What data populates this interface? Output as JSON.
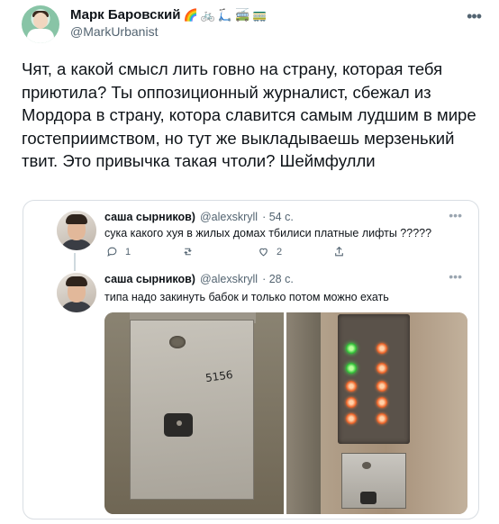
{
  "tweet": {
    "author": {
      "display_name": "Марк Баровский",
      "handle": "@MarkUrbanist",
      "name_emojis": [
        "🌈",
        "🚲",
        "🛴",
        "🚎",
        "🚃"
      ]
    },
    "text": "Чят, а какой смысл лить говно на страну, которая тебя приютила? Ты оппозиционный журналист, сбежал из Мордора в страну, котора славится самым лудшим в мире гостеприимством, но тут же выкладываешь мерзенький твит. Это привычка такая чтоли? Шеймфулли",
    "more_icon": "more-horizontal-icon"
  },
  "quoted": {
    "first": {
      "name": "саша сырников)",
      "handle": "@alexskryll",
      "time": "· 54 с.",
      "text": "сука какого хуя в жилых домах тбилиси платные лифты ?????",
      "reply_count": "1",
      "retweet_count": "",
      "like_count": "2"
    },
    "second": {
      "name": "саша сырников)",
      "handle": "@alexskryll",
      "time": "· 28 с.",
      "text": "типа надо закинуть бабок и только потом можно ехать",
      "photo_left_scribble": "5156"
    }
  },
  "colors": {
    "text_primary": "#0f1419",
    "text_secondary": "#536471",
    "border": "#d9dee3",
    "led_green": "#38c53c",
    "led_orange": "#ef6a2f"
  }
}
